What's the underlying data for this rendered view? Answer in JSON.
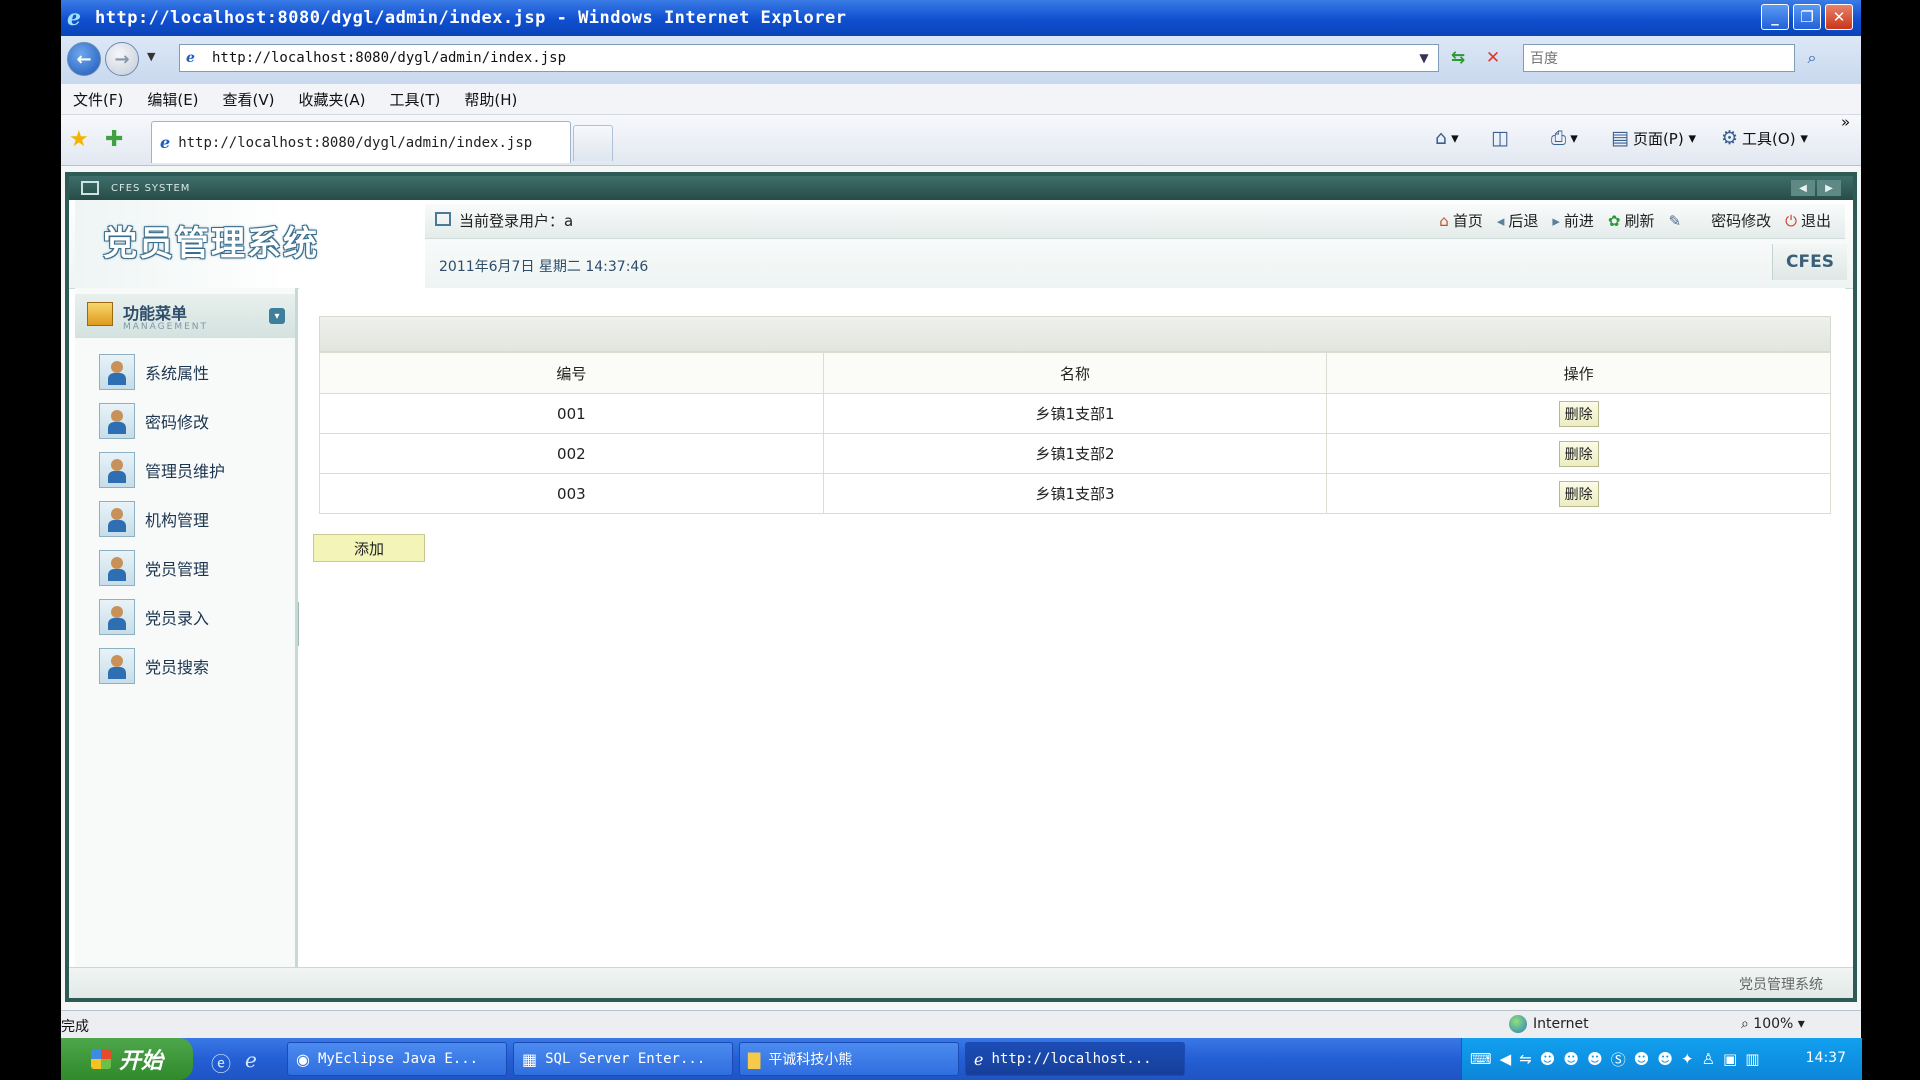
{
  "window": {
    "title": "http://localhost:8080/dygl/admin/index.jsp - Windows Internet Explorer"
  },
  "address": {
    "url": "http://localhost:8080/dygl/admin/index.jsp",
    "search_placeholder": "百度"
  },
  "menu": [
    "文件(F)",
    "编辑(E)",
    "查看(V)",
    "收藏夹(A)",
    "工具(T)",
    "帮助(H)"
  ],
  "tab": {
    "title": "http://localhost:8080/dygl/admin/index.jsp"
  },
  "commands": {
    "page": "页面(P)",
    "tools": "工具(O)"
  },
  "app": {
    "system_label": "CFES SYSTEM",
    "logo": "党员管理系统",
    "user_label": "当前登录用户：a",
    "links": {
      "home": "首页",
      "back": "后退",
      "forward": "前进",
      "refresh": "刷新",
      "password": "密码修改",
      "logout": "退出"
    },
    "datetime": "2011年6月7日  星期二  14:37:46",
    "badge": "CFES",
    "footer": "党员管理系统"
  },
  "sidebar": {
    "title": "功能菜单",
    "subtitle": "MANAGEMENT",
    "items": [
      "系统属性",
      "密码修改",
      "管理员维护",
      "机构管理",
      "党员管理",
      "党员录入",
      "党员搜索"
    ]
  },
  "table": {
    "headers": [
      "编号",
      "名称",
      "操作"
    ],
    "rows": [
      {
        "id": "001",
        "name": "乡镇1支部1",
        "action": "删除"
      },
      {
        "id": "002",
        "name": "乡镇1支部2",
        "action": "删除"
      },
      {
        "id": "003",
        "name": "乡镇1支部3",
        "action": "删除"
      }
    ],
    "add_label": "添加"
  },
  "statusbar": {
    "text": "完成",
    "zone": "Internet",
    "zoom": "100%"
  },
  "taskbar": {
    "start": "开始",
    "tasks": [
      "MyEclipse Java E...",
      "SQL Server Enter...",
      "平诚科技小熊",
      "http://localhost..."
    ],
    "time": "14:37"
  },
  "colors": {
    "frame": "#2f5b57",
    "add_button": "#f3f4b8",
    "titlebar": "#0f4fcf"
  }
}
